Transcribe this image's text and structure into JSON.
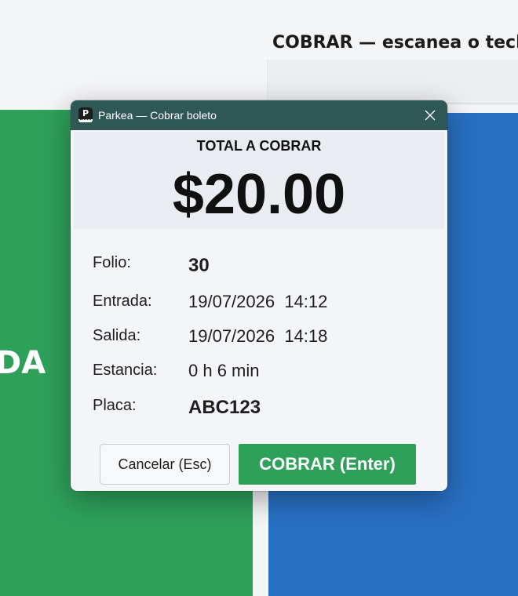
{
  "background": {
    "heading": "COBRAR — escanea o tecle",
    "green_panel_text": "DA",
    "colors": {
      "green": "#2ea05a",
      "blue": "#2870c2"
    }
  },
  "dialog": {
    "title": "Parkea — Cobrar boleto",
    "app_icon_letter": "P",
    "close_icon": "close-icon",
    "total_label": "TOTAL A COBRAR",
    "total_amount": "$20.00",
    "rows": [
      {
        "label": "Folio:",
        "value": "30"
      },
      {
        "label": "Entrada:",
        "value": "19/07/2026  14:12"
      },
      {
        "label": "Salida:",
        "value": "19/07/2026  14:18"
      },
      {
        "label": "Estancia:",
        "value": "0 h 6 min"
      },
      {
        "label": "Placa:",
        "value": "ABC123"
      }
    ],
    "cancel_label": "Cancelar (Esc)",
    "confirm_label": "COBRAR (Enter)",
    "colors": {
      "titlebar": "#2f5753",
      "confirm": "#2ea05a"
    }
  }
}
